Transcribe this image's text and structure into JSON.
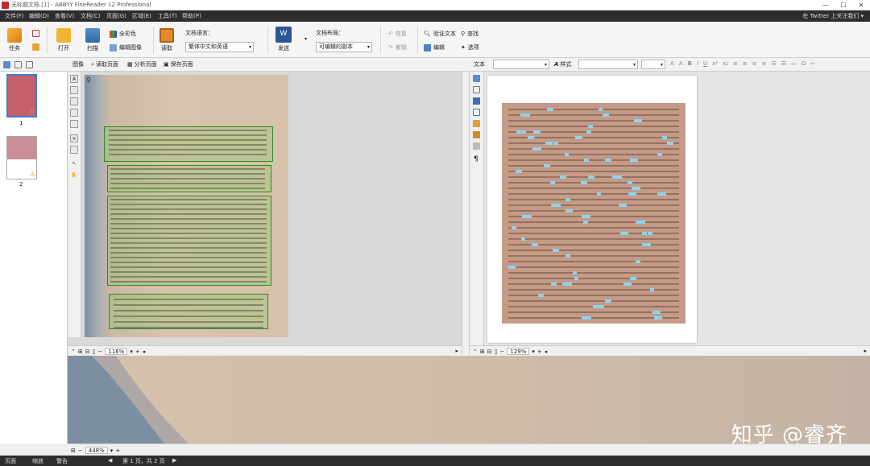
{
  "window": {
    "title": "无标题文档 [1] - ABBYY FineReader 12 Professional",
    "minimize": "—",
    "maximize": "☐",
    "close": "✕"
  },
  "menu": {
    "items": [
      "文件(F)",
      "编辑(D)",
      "查看(V)",
      "文档(C)",
      "页面(G)",
      "区域(E)",
      "工具(T)",
      "帮助(P)"
    ],
    "right_text": "在 Twitter 上关注我们 ▾"
  },
  "ribbon": {
    "task": "任务",
    "open": "打开",
    "scan": "扫描",
    "full_color": "全彩色",
    "edit_image": "编辑图像",
    "read": "读取",
    "doc_language_label": "文档语言：",
    "doc_language_value": "繁体中文和英语",
    "send": "发送",
    "doc_layout_label": "文档布局：",
    "doc_layout_value": "可编辑的副本",
    "undo": "恢复",
    "redo": "撤销",
    "verify_text": "验证文本",
    "find": "查找",
    "edit": "编辑",
    "options": "选项"
  },
  "image_toolbar": {
    "label": "图像",
    "read_page": "读取页面",
    "analyze_page": "分析页面",
    "save_page": "保存页面"
  },
  "text_toolbar": {
    "label": "文本",
    "style": "样式",
    "format_buttons": [
      "B",
      "I",
      "U",
      "x²",
      "x₂"
    ]
  },
  "pages": [
    {
      "number": "1",
      "color": "#c4606a"
    },
    {
      "number": "2",
      "color": "#c98e97"
    }
  ],
  "image_zoom": "116%",
  "text_zoom": "129%",
  "zoom_window_zoom": "448%",
  "watermark": "知乎 @睿齐",
  "bottombar": {
    "tabs": [
      "页面",
      "缩放",
      "警告"
    ],
    "page_info": "第 1 页，共 2 页"
  }
}
